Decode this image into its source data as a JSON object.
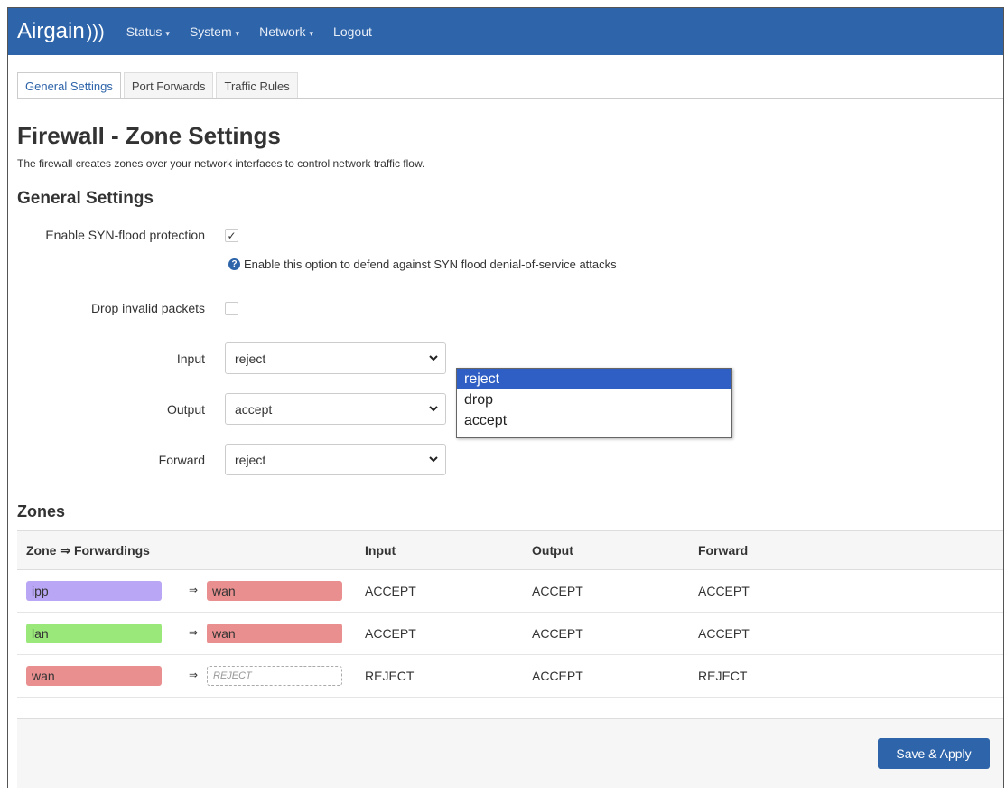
{
  "navbar": {
    "brand": "Airgain",
    "brand_suffix": ")))",
    "items": [
      {
        "label": "Status",
        "caret": "▾"
      },
      {
        "label": "System",
        "caret": "▾"
      },
      {
        "label": "Network",
        "caret": "▾"
      },
      {
        "label": "Logout",
        "caret": ""
      }
    ]
  },
  "tabs": [
    {
      "label": "General Settings",
      "active": true
    },
    {
      "label": "Port Forwards",
      "active": false
    },
    {
      "label": "Traffic Rules",
      "active": false
    }
  ],
  "page": {
    "title": "Firewall - Zone Settings",
    "description": "The firewall creates zones over your network interfaces to control network traffic flow."
  },
  "general": {
    "heading": "General Settings",
    "syn_label": "Enable SYN-flood protection",
    "syn_checked": true,
    "syn_checkmark": "✓",
    "syn_help": "Enable this option to defend against SYN flood denial-of-service attacks",
    "help_icon": "?",
    "drop_label": "Drop invalid packets",
    "drop_checked": false,
    "input_label": "Input",
    "input_value": "reject",
    "output_label": "Output",
    "output_value": "accept",
    "forward_label": "Forward",
    "forward_value": "reject"
  },
  "dropdown": {
    "options": [
      "reject",
      "drop",
      "accept"
    ],
    "selected": "reject"
  },
  "zones": {
    "heading": "Zones",
    "columns": [
      "Zone ⇒ Forwardings",
      "Input",
      "Output",
      "Forward"
    ],
    "arrow": "⇒",
    "rows": [
      {
        "zone": "ipp",
        "zone_color": "#b9a6f5",
        "fwd": "wan",
        "fwd_color": "#ea8f8f",
        "input": "ACCEPT",
        "output": "ACCEPT",
        "forward": "ACCEPT"
      },
      {
        "zone": "lan",
        "zone_color": "#9be87a",
        "fwd": "wan",
        "fwd_color": "#ea8f8f",
        "input": "ACCEPT",
        "output": "ACCEPT",
        "forward": "ACCEPT"
      },
      {
        "zone": "wan",
        "zone_color": "#ea8f8f",
        "fwd": "REJECT",
        "fwd_color": "",
        "input": "REJECT",
        "output": "ACCEPT",
        "forward": "REJECT"
      }
    ]
  },
  "footer": {
    "save_label": "Save & Apply"
  },
  "colors": {
    "accent": "#2e64a9",
    "dropdown_highlight": "#2f5fc4"
  }
}
